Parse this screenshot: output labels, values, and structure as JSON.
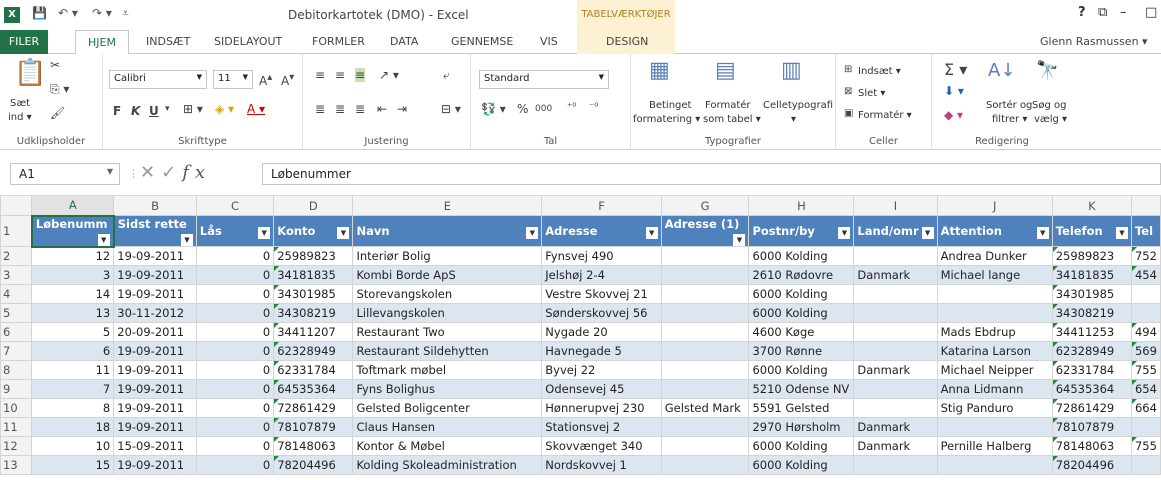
{
  "titlebar": {
    "logo": "X",
    "window_title": "Debitorkartotek (DMO) - Excel",
    "context_tools": "TABELVÆRKTØJER",
    "help": "?",
    "restore_icon": "⧉",
    "min_icon": "–",
    "max_icon": "□"
  },
  "tabs": {
    "filer": "FILER",
    "hjem": "HJEM",
    "indsaet": "INDSÆT",
    "sidelayout": "SIDELAYOUT",
    "formler": "FORMLER",
    "data": "DATA",
    "gennemse": "GENNEMSE",
    "vis": "VIS",
    "design": "DESIGN",
    "user": "Glenn Rasmussen ▾"
  },
  "ribbon": {
    "clipboard": {
      "paste": "Sæt",
      "paste2": "ind ▾",
      "label": "Udklipsholder"
    },
    "font": {
      "name": "Calibri",
      "size": "11",
      "bold": "F",
      "italic": "K",
      "underline": "U",
      "label": "Skrifttype"
    },
    "alignment": {
      "label": "Justering"
    },
    "number": {
      "format": "Standard",
      "percent": "%",
      "thousands": "000",
      "label": "Tal"
    },
    "styles": {
      "cond1": "Betinget",
      "cond2": "formatering ▾",
      "table1": "Formatér",
      "table2": "som tabel ▾",
      "cell1": "Celletypografi",
      "cell2": "▾",
      "label": "Typografier"
    },
    "cells": {
      "insert": "Indsæt ▾",
      "delete": "Slet ▾",
      "format": "Formatér ▾",
      "label": "Celler"
    },
    "editing": {
      "sort1": "Sortér og",
      "sort2": "filtrer ▾",
      "find1": "Søg og",
      "find2": "vælg ▾",
      "label": "Redigering"
    }
  },
  "formula_bar": {
    "name_box": "A1",
    "formula": "Løbenummer",
    "fx": "fx"
  },
  "grid": {
    "col_letters": [
      "A",
      "B",
      "C",
      "D",
      "E",
      "F",
      "G",
      "H",
      "I",
      "J",
      "K",
      ""
    ],
    "headers": [
      "Løbenumm",
      "Sidst rette",
      "Lås",
      "Konto",
      "Navn",
      "Adresse",
      "Adresse (1)",
      "Postnr/by",
      "Land/omr",
      "Attention",
      "Telefon",
      "Tel"
    ],
    "rows": [
      [
        "12",
        "19-09-2011",
        "0",
        "25989823",
        "Interiør Bolig",
        "Fynsvej 490",
        "",
        "6000  Kolding",
        "",
        "Andrea Dunker",
        "25989823",
        "752"
      ],
      [
        "3",
        "19-09-2011",
        "0",
        "34181835",
        "Kombi Borde ApS",
        "Jelshøj 2-4",
        "",
        "2610 Rødovre",
        "Danmark",
        "Michael lange",
        "34181835",
        "454"
      ],
      [
        "14",
        "19-09-2011",
        "0",
        "34301985",
        "Storevangskolen",
        "Vestre Skovvej 21",
        "",
        "6000  Kolding",
        "",
        "",
        "34301985",
        ""
      ],
      [
        "13",
        "30-11-2012",
        "0",
        "34308219",
        "Lillevangskolen",
        "Sønderskovvej 56",
        "",
        "6000  Kolding",
        "",
        "",
        "34308219",
        ""
      ],
      [
        "5",
        "20-09-2011",
        "0",
        "34411207",
        "Restaurant Two",
        "Nygade 20",
        "",
        "4600  Køge",
        "",
        "Mads Ebdrup",
        "34411253",
        "494"
      ],
      [
        "6",
        "19-09-2011",
        "0",
        "62328949",
        "Restaurant Sildehytten",
        "Havnegade 5",
        "",
        "3700  Rønne",
        "",
        "Katarina Larson",
        "62328949",
        "569"
      ],
      [
        "11",
        "19-09-2011",
        "0",
        "62331784",
        "Toftmark møbel",
        "Byvej 22",
        "",
        "6000 Kolding",
        "Danmark",
        "Michael Neipper",
        "62331784",
        "755"
      ],
      [
        "7",
        "19-09-2011",
        "0",
        "64535364",
        "Fyns Bolighus",
        "Odensevej 45",
        "",
        "5210  Odense NV",
        "",
        "Anna Lidmann",
        "64535364",
        "654"
      ],
      [
        "8",
        "19-09-2011",
        "0",
        "72861429",
        "Gelsted Boligcenter",
        "Hønnerupvej 230",
        "Gelsted Mark",
        "5591  Gelsted",
        "",
        "Stig Panduro",
        "72861429",
        "664"
      ],
      [
        "18",
        "19-09-2011",
        "0",
        "78107879",
        "Claus Hansen",
        "Stationsvej 2",
        "",
        "2970  Hørsholm",
        "Danmark",
        "",
        "78107879",
        ""
      ],
      [
        "10",
        "15-09-2011",
        "0",
        "78148063",
        "Kontor & Møbel",
        "Skovvænget 340",
        "",
        "6000 Kolding",
        "Danmark",
        "Pernille Halberg",
        "78148063",
        "755"
      ],
      [
        "15",
        "19-09-2011",
        "0",
        "78204496",
        "Kolding Skoleadministration",
        "Nordskovvej 1",
        "",
        "6000  Kolding",
        "",
        "",
        "78204496",
        ""
      ]
    ]
  }
}
